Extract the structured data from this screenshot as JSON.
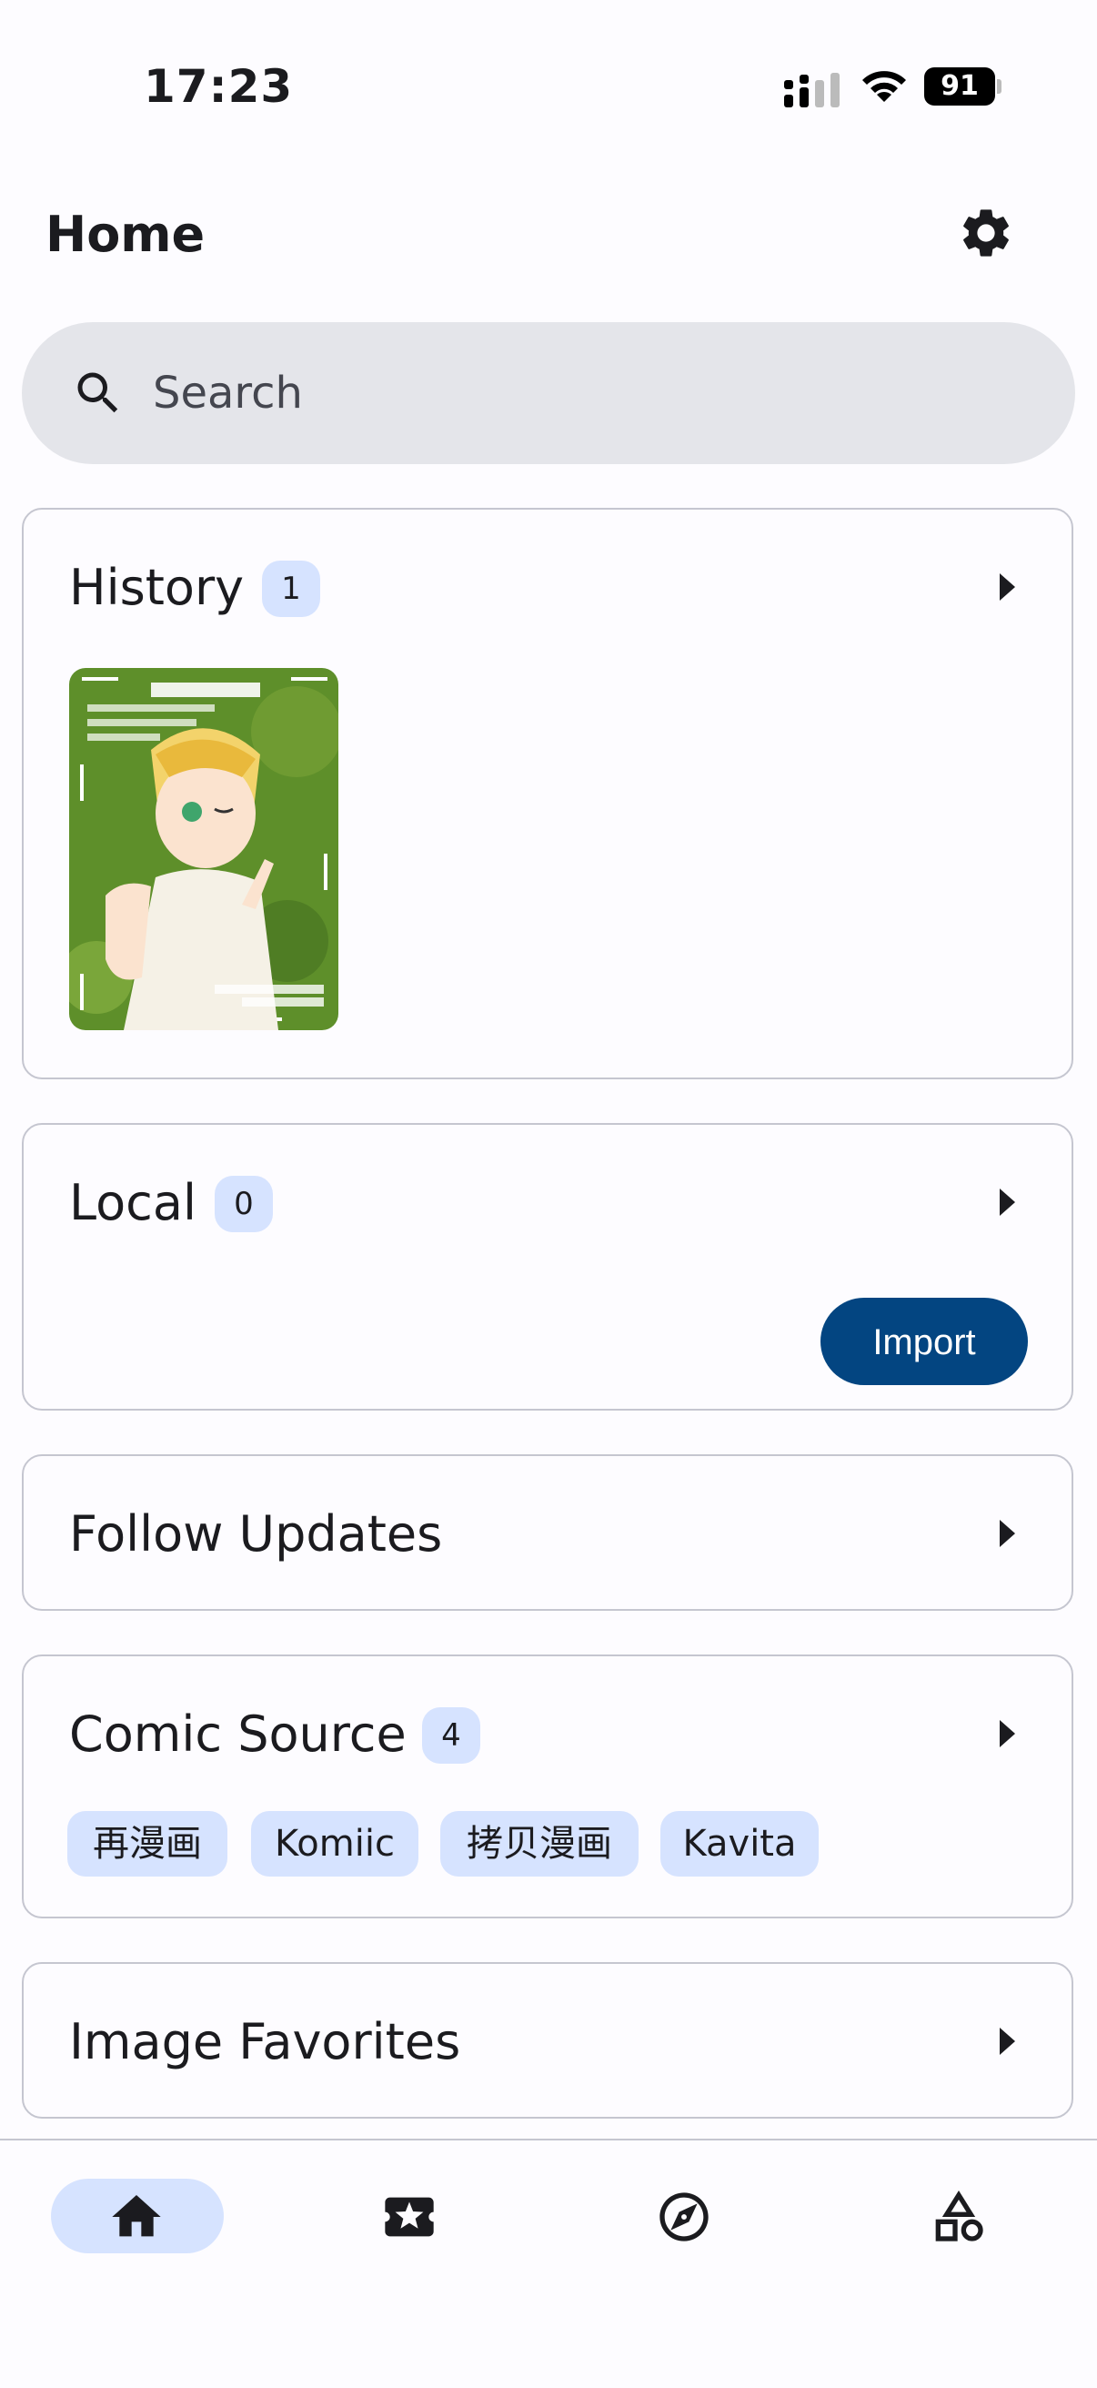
{
  "status_bar": {
    "time": "17:23",
    "battery": "91"
  },
  "app_bar": {
    "title": "Home"
  },
  "search": {
    "placeholder": "Search"
  },
  "history": {
    "title": "History",
    "count": "1"
  },
  "local": {
    "title": "Local",
    "count": "0",
    "import_label": "Import"
  },
  "follow_updates": {
    "title": "Follow Updates"
  },
  "comic_source": {
    "title": "Comic Source",
    "count": "4",
    "chips": [
      "再漫画",
      "Komiic",
      "拷贝漫画",
      "Kavita"
    ]
  },
  "image_favorites": {
    "title": "Image Favorites"
  },
  "bottom_nav": {
    "items": [
      "home-icon",
      "ticket-star-icon",
      "compass-icon",
      "categories-icon"
    ],
    "selected": "home-icon"
  },
  "colors": {
    "accent": "#034581",
    "chip": "#d6e3ff",
    "search_bg": "#e4e5ea",
    "border": "#c5c6d0"
  }
}
